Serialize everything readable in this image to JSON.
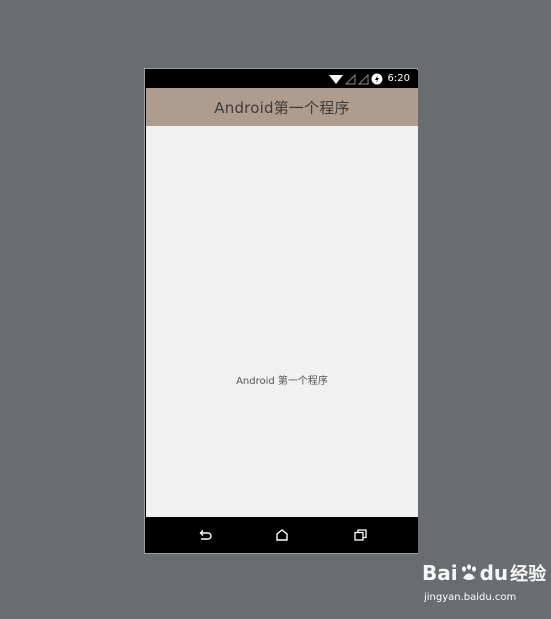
{
  "status_bar": {
    "time": "6:20"
  },
  "app_bar": {
    "title": "Android第一个程序"
  },
  "content": {
    "text": "Android 第一个程序"
  },
  "watermark": {
    "logo_bai": "Bai",
    "logo_du": "du",
    "logo_jingyan": "经验",
    "url": "jingyan.baidu.com"
  },
  "colors": {
    "app_bar": "#ae9d8f",
    "background": "#696d70",
    "content": "#f1f1f1"
  },
  "icons": {
    "status": [
      "wifi-icon",
      "signal-icon",
      "signal-icon",
      "battery-charging-icon"
    ],
    "nav": [
      "back-icon",
      "home-icon",
      "recent-apps-icon"
    ]
  }
}
